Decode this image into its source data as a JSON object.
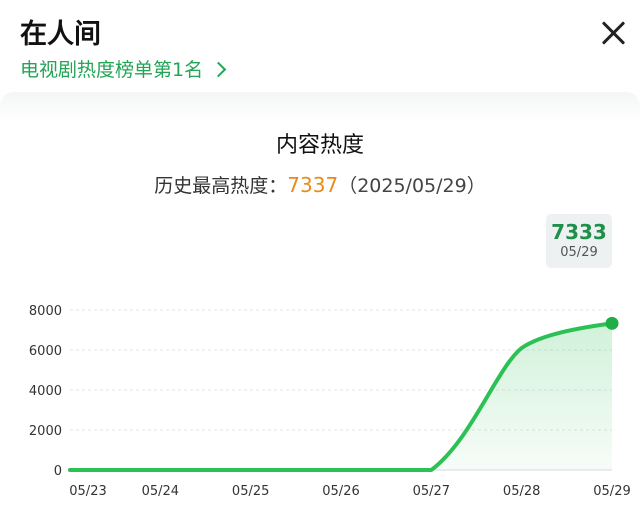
{
  "header": {
    "title": "在人间",
    "subtitle": "电视剧热度榜单第1名"
  },
  "card": {
    "title": "内容热度",
    "peak_label": "历史最高热度：",
    "peak_value": "7337",
    "peak_date": "（2025/05/29）"
  },
  "tooltip": {
    "value": "7333",
    "date": "05/29"
  },
  "icons": {
    "close": "close-icon",
    "link_arrow": "chevron-right-icon"
  },
  "colors": {
    "accent_green": "#23a456",
    "line_green": "#2cc055",
    "peak_orange": "#e88b1b"
  },
  "chart_data": {
    "type": "area",
    "categories": [
      "05/23",
      "05/24",
      "05/25",
      "05/26",
      "05/27",
      "05/28",
      "05/29"
    ],
    "values": [
      0,
      0,
      0,
      0,
      0,
      6100,
      7333
    ],
    "ylim": [
      0,
      8000
    ],
    "yticks": [
      "0",
      "2000",
      "4000",
      "6000",
      "8000"
    ],
    "grid": true,
    "xlabel": "",
    "ylabel": ""
  }
}
